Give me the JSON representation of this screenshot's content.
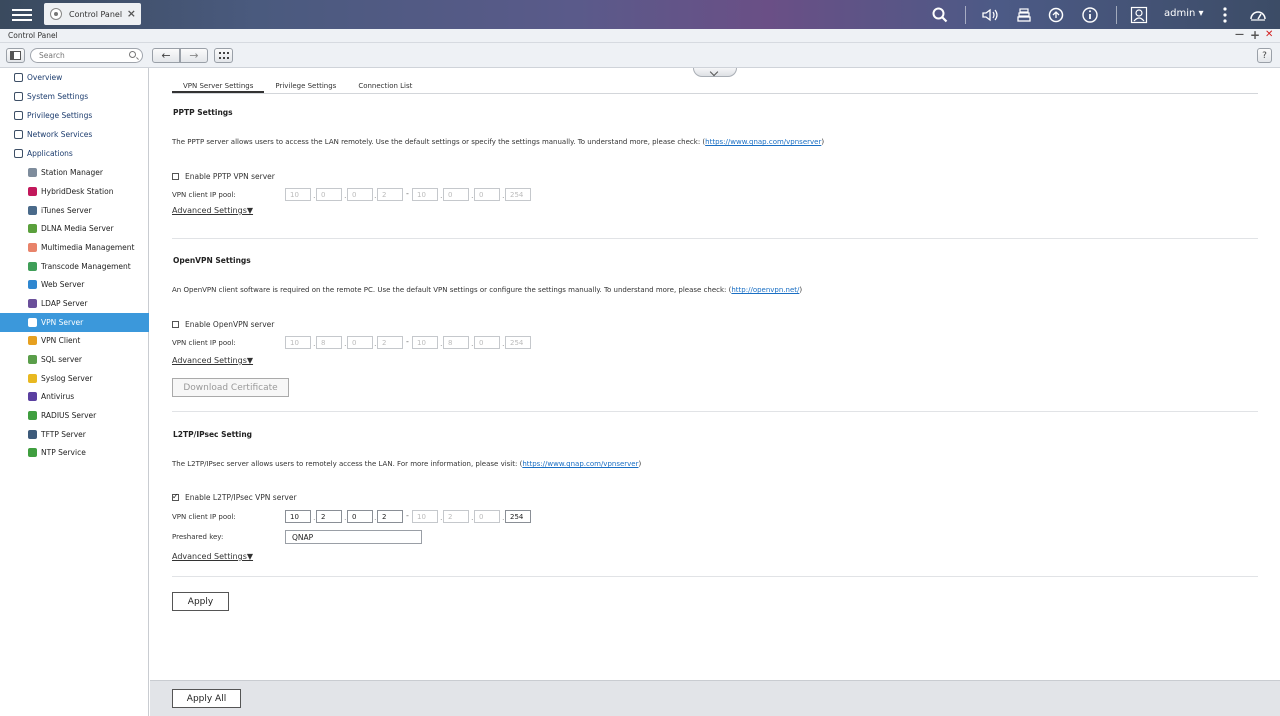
{
  "topbar": {
    "tab_title": "Control Panel",
    "user": "admin ▾",
    "icons": [
      "search-icon",
      "volume-icon",
      "tasks-icon",
      "sync-icon",
      "info-icon",
      "user-icon",
      "more-icon",
      "dashboard-icon"
    ]
  },
  "window": {
    "title": "Control Panel",
    "minimize": "—",
    "maximize": "+",
    "close": "✕"
  },
  "toolbar": {
    "search_placeholder": "Search",
    "back": "←",
    "forward": "→",
    "grid": "⋮⋮⋮",
    "help": "?"
  },
  "sidebar": {
    "items": [
      {
        "label": "Overview",
        "level": "top",
        "icon": "overview-icon",
        "color": "#3d4f66"
      },
      {
        "label": "System Settings",
        "level": "top",
        "icon": "gear-icon",
        "color": "#3d4f66"
      },
      {
        "label": "Privilege Settings",
        "level": "top",
        "icon": "user-icon",
        "color": "#3d4f66"
      },
      {
        "label": "Network Services",
        "level": "top",
        "icon": "globe-icon",
        "color": "#3d4f66"
      },
      {
        "label": "Applications",
        "level": "top",
        "icon": "apps-icon",
        "color": "#3d4f66"
      },
      {
        "label": "Station Manager",
        "level": "sub",
        "icon": "station-icon",
        "color": "#7e8c9c"
      },
      {
        "label": "HybridDesk Station",
        "level": "sub",
        "icon": "hybriddesk-icon",
        "color": "#c2185b"
      },
      {
        "label": "iTunes Server",
        "level": "sub",
        "icon": "itunes-icon",
        "color": "#4a6a8a"
      },
      {
        "label": "DLNA Media Server",
        "level": "sub",
        "icon": "dlna-icon",
        "color": "#5aa03c"
      },
      {
        "label": "Multimedia Management",
        "level": "sub",
        "icon": "multimedia-icon",
        "color": "#e8836a"
      },
      {
        "label": "Transcode Management",
        "level": "sub",
        "icon": "transcode-icon",
        "color": "#3f9e58"
      },
      {
        "label": "Web Server",
        "level": "sub",
        "icon": "web-icon",
        "color": "#2f87d0"
      },
      {
        "label": "LDAP Server",
        "level": "sub",
        "icon": "ldap-icon",
        "color": "#6a4f9a"
      },
      {
        "label": "VPN Server",
        "level": "sub",
        "icon": "vpn-server-icon",
        "color": "#ffffff",
        "selected": true
      },
      {
        "label": "VPN Client",
        "level": "sub",
        "icon": "vpn-client-icon",
        "color": "#e6a020"
      },
      {
        "label": "SQL server",
        "level": "sub",
        "icon": "sql-icon",
        "color": "#5a9e4a"
      },
      {
        "label": "Syslog Server",
        "level": "sub",
        "icon": "syslog-icon",
        "color": "#e8b820"
      },
      {
        "label": "Antivirus",
        "level": "sub",
        "icon": "antivirus-icon",
        "color": "#5a3fa0"
      },
      {
        "label": "RADIUS Server",
        "level": "sub",
        "icon": "radius-icon",
        "color": "#3f9e3f"
      },
      {
        "label": "TFTP Server",
        "level": "sub",
        "icon": "tftp-icon",
        "color": "#3d5a7a"
      },
      {
        "label": "NTP Service",
        "level": "sub",
        "icon": "ntp-icon",
        "color": "#3f9e3f"
      }
    ]
  },
  "tabs": [
    "VPN Server Settings",
    "Privilege Settings",
    "Connection List"
  ],
  "pptp": {
    "title": "PPTP Settings",
    "desc": "The PPTP server allows users to access the LAN remotely. Use the default settings or specify the settings manually. To understand more, please check: (",
    "link": "https://www.qnap.com/vpnserver",
    "desc_end": ")",
    "enable_label": "Enable PPTP VPN server",
    "enabled": false,
    "pool_label": "VPN client IP pool:",
    "pool_start": [
      "10",
      "0",
      "0",
      "2"
    ],
    "pool_end": [
      "10",
      "0",
      "0",
      "254"
    ],
    "advanced": "Advanced Settings▼"
  },
  "openvpn": {
    "title": "OpenVPN Settings",
    "desc": "An OpenVPN client software is required on the remote PC. Use the default VPN settings or configure the settings manually. To understand more, please check: (",
    "link": "http://openvpn.net/",
    "desc_end": ")",
    "enable_label": "Enable OpenVPN server",
    "enabled": false,
    "pool_label": "VPN client IP pool:",
    "pool_start": [
      "10",
      "8",
      "0",
      "2"
    ],
    "pool_end": [
      "10",
      "8",
      "0",
      "254"
    ],
    "advanced": "Advanced Settings▼",
    "download_cert": "Download Certificate"
  },
  "l2tp": {
    "title": "L2TP/IPsec Setting",
    "desc": "The L2TP/IPsec server allows users to remotely access the LAN. For more information, please visit: (",
    "link": "https://www.qnap.com/vpnserver",
    "desc_end": ")",
    "enable_label": "Enable L2TP/IPsec VPN server",
    "enabled": true,
    "pool_label": "VPN client IP pool:",
    "pool_start": [
      "10",
      "2",
      "0",
      "2"
    ],
    "pool_end": [
      "10",
      "2",
      "0",
      "254"
    ],
    "psk_label": "Preshared key:",
    "psk_value": "QNAP",
    "advanced": "Advanced Settings▼"
  },
  "apply": "Apply",
  "apply_all": "Apply All"
}
